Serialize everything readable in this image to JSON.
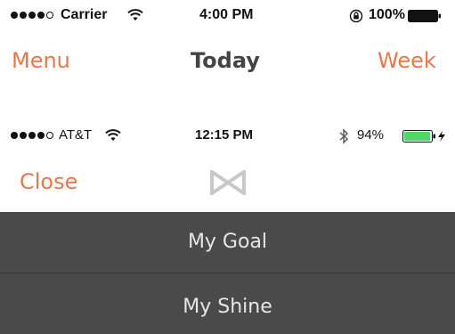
{
  "status_bar_1": {
    "carrier": "Carrier",
    "time": "4:00 PM",
    "battery": "100%",
    "signal_bars_filled": 4,
    "battery_level": 1.0
  },
  "nav_bar": {
    "left": "Menu",
    "title": "Today",
    "right": "Week"
  },
  "status_bar_2": {
    "carrier": "AT&T",
    "time": "12:15 PM",
    "battery": "94%",
    "signal_bars_filled": 4,
    "battery_level": 0.94,
    "battery_color": "#4cd964"
  },
  "overlay_header": {
    "close": "Close",
    "logo_icon": "misfit-logo-icon"
  },
  "menu": {
    "items": [
      {
        "label": "My Goal"
      },
      {
        "label": "My Shine"
      }
    ]
  },
  "colors": {
    "accent": "#e8774a",
    "menu_bg": "#4a4a4a",
    "menu_text": "#e6e6e6"
  }
}
